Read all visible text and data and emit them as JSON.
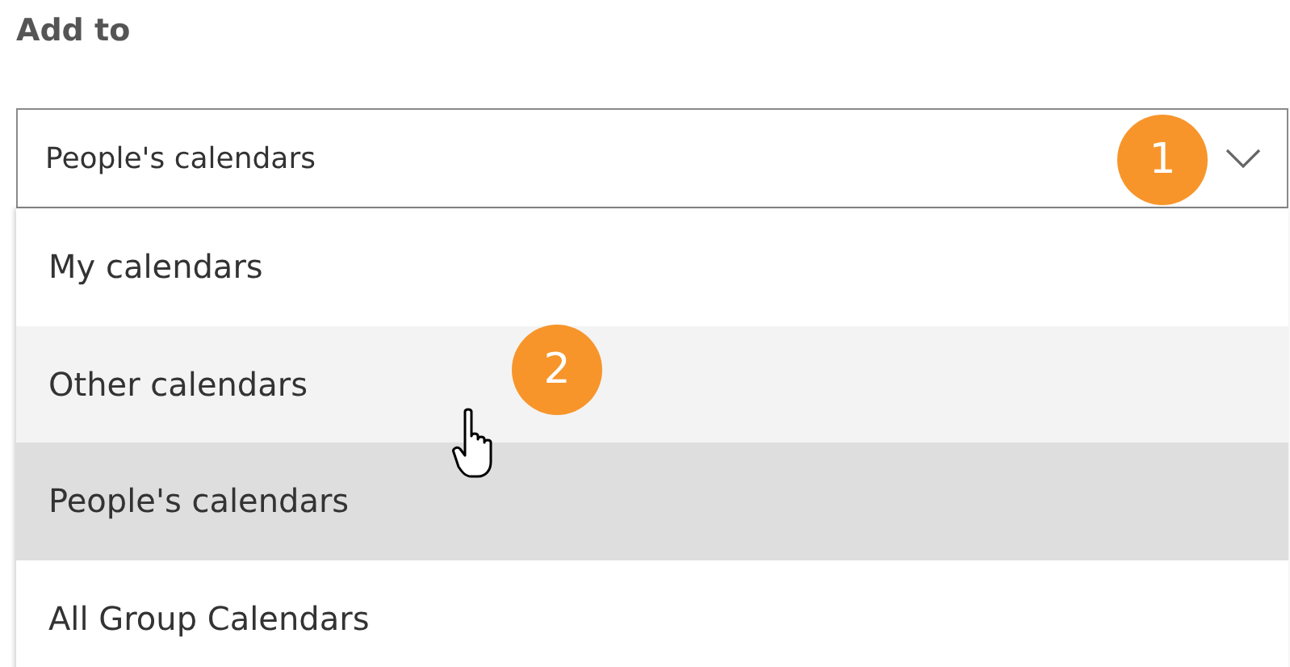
{
  "label": "Add to",
  "dropdown": {
    "value": "People's calendars",
    "expanded": true
  },
  "options": [
    {
      "label": "My calendars",
      "hovered": false,
      "selected": false
    },
    {
      "label": "Other calendars",
      "hovered": true,
      "selected": false
    },
    {
      "label": "People's calendars",
      "hovered": false,
      "selected": true
    },
    {
      "label": "All Group Calendars",
      "hovered": false,
      "selected": false
    }
  ],
  "callouts": [
    {
      "number": "1"
    },
    {
      "number": "2"
    }
  ]
}
